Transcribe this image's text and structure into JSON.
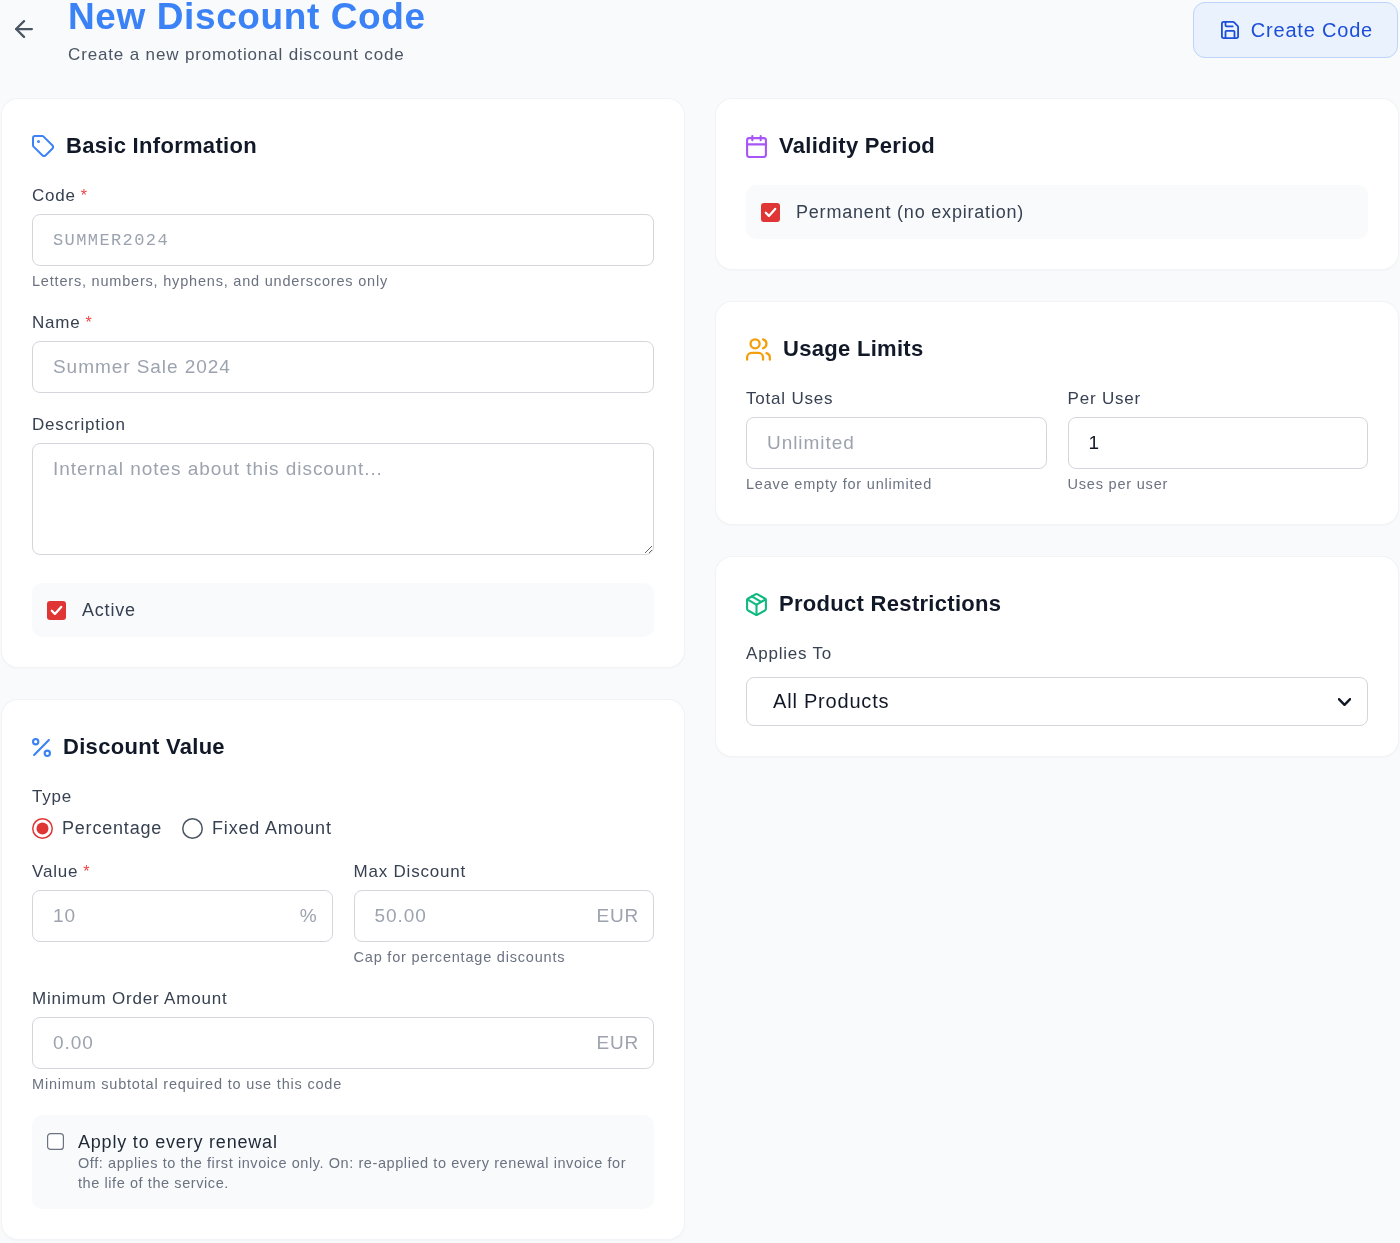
{
  "header": {
    "title": "New Discount Code",
    "subtitle": "Create a new promotional discount code",
    "create_button": "Create Code"
  },
  "basic_information": {
    "title": "Basic Information",
    "fields": [
      {
        "kind": "code",
        "label": "Code",
        "required_mark": "*",
        "placeholder": "SUMMER2024",
        "help": "Letters, numbers, hyphens, and underscores only"
      },
      {
        "kind": "text",
        "label": "Name",
        "required_mark": "*",
        "placeholder": "Summer Sale 2024"
      },
      {
        "kind": "textarea",
        "label": "Description",
        "placeholder": "Internal notes about this discount..."
      },
      {
        "kind": "checkbox",
        "label": "Active",
        "checked": true
      }
    ]
  },
  "discount_value": {
    "title": "Discount Value",
    "fields": [
      {
        "kind": "radio_group",
        "label": "Type",
        "options": [
          {
            "label": "Percentage",
            "selected": true
          },
          {
            "label": "Fixed Amount",
            "selected": false
          }
        ]
      },
      {
        "kind": "row",
        "fields": [
          {
            "kind": "text",
            "label": "Value",
            "required_mark": "*",
            "placeholder": "10",
            "suffix": "%"
          },
          {
            "kind": "text",
            "label": "Max Discount",
            "placeholder": "50.00",
            "suffix": "EUR",
            "help": "Cap for percentage discounts"
          }
        ]
      },
      {
        "kind": "text",
        "label": "Minimum Order Amount",
        "placeholder": "0.00",
        "suffix": "EUR",
        "help": "Minimum subtotal required to use this code"
      },
      {
        "kind": "checkbox",
        "label": "Apply to every renewal",
        "checked": false,
        "description": "Off: applies to the first invoice only. On: re-applied to every renewal invoice for the life of the service."
      }
    ]
  },
  "validity_period": {
    "title": "Validity Period",
    "fields": [
      {
        "kind": "checkbox",
        "label": "Permanent (no expiration)",
        "checked": true
      }
    ]
  },
  "usage_limits": {
    "title": "Usage Limits",
    "fields": [
      {
        "kind": "row",
        "fields": [
          {
            "kind": "text",
            "label": "Total Uses",
            "placeholder": "Unlimited",
            "help": "Leave empty for unlimited"
          },
          {
            "kind": "text",
            "label": "Per User",
            "value": "1",
            "help": "Uses per user"
          }
        ]
      }
    ]
  },
  "product_restrictions": {
    "title": "Product Restrictions",
    "fields": [
      {
        "kind": "select",
        "label": "Applies To",
        "value": "All Products"
      }
    ]
  }
}
